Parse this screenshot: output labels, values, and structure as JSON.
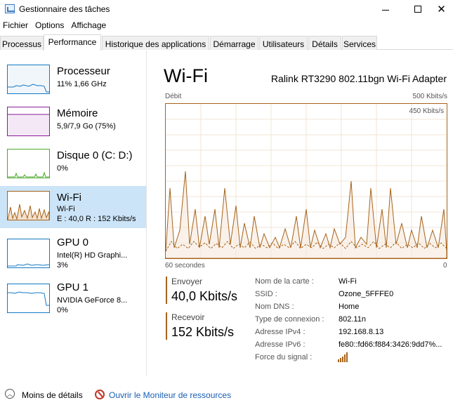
{
  "window": {
    "title": "Gestionnaire des tâches",
    "controls": {
      "minimize": "—",
      "maximize": "☐",
      "close": "✕"
    }
  },
  "menu": [
    "Fichier",
    "Options",
    "Affichage"
  ],
  "tabs": [
    {
      "label": "Processus",
      "active": false
    },
    {
      "label": "Performance",
      "active": true
    },
    {
      "label": "Historique des applications",
      "active": false
    },
    {
      "label": "Démarrage",
      "active": false
    },
    {
      "label": "Utilisateurs",
      "active": false
    },
    {
      "label": "Détails",
      "active": false
    },
    {
      "label": "Services",
      "active": false
    }
  ],
  "sidebar": {
    "items": [
      {
        "name": "Processeur",
        "line1": "11% 1,66 GHz",
        "line2": "",
        "color": "#1179c5"
      },
      {
        "name": "Mémoire",
        "line1": "5,9/7,9 Go (75%)",
        "line2": "",
        "color": "#8b1a9b"
      },
      {
        "name": "Disque 0 (C: D:)",
        "line1": "0%",
        "line2": "",
        "color": "#4ea72e"
      },
      {
        "name": "Wi-Fi",
        "line1": "Wi-Fi",
        "line2": "E : 40,0 R : 152 Kbits/s",
        "color": "#a6631b"
      },
      {
        "name": "GPU 0",
        "line1": "Intel(R) HD Graphi...",
        "line2": "3%",
        "color": "#1179c5"
      },
      {
        "name": "GPU 1",
        "line1": "NVIDIA GeForce 8...",
        "line2": "0%",
        "color": "#1179c5"
      }
    ]
  },
  "main": {
    "title": "Wi-Fi",
    "adapter": "Ralink RT3290 802.11bgn Wi-Fi Adapter",
    "graph": {
      "label_left": "Débit",
      "label_max": "500 Kbits/s",
      "label_inner": "450 Kbits/s",
      "label_time": "60 secondes",
      "label_zero": "0",
      "color": "#a6631b"
    },
    "send": {
      "label": "Envoyer",
      "value": "40,0 Kbits/s"
    },
    "receive": {
      "label": "Recevoir",
      "value": "152 Kbits/s"
    },
    "properties": [
      {
        "label": "Nom de la carte :",
        "value": "Wi-Fi"
      },
      {
        "label": "SSID :",
        "value": "Ozone_5FFFE0"
      },
      {
        "label": "Nom DNS :",
        "value": "Home"
      },
      {
        "label": "Type de connexion :",
        "value": "802.11n"
      },
      {
        "label": "Adresse IPv4 :",
        "value": "192.168.8.13"
      },
      {
        "label": "Adresse IPv6 :",
        "value": "fe80::fd66:f884:3426:9dd7%..."
      },
      {
        "label": "Force du signal :",
        "value": ""
      }
    ]
  },
  "footer": {
    "less_details": "Moins de détails",
    "open_monitor": "Ouvrir le Moniteur de ressources",
    "link_color": "#1a5fb4"
  }
}
